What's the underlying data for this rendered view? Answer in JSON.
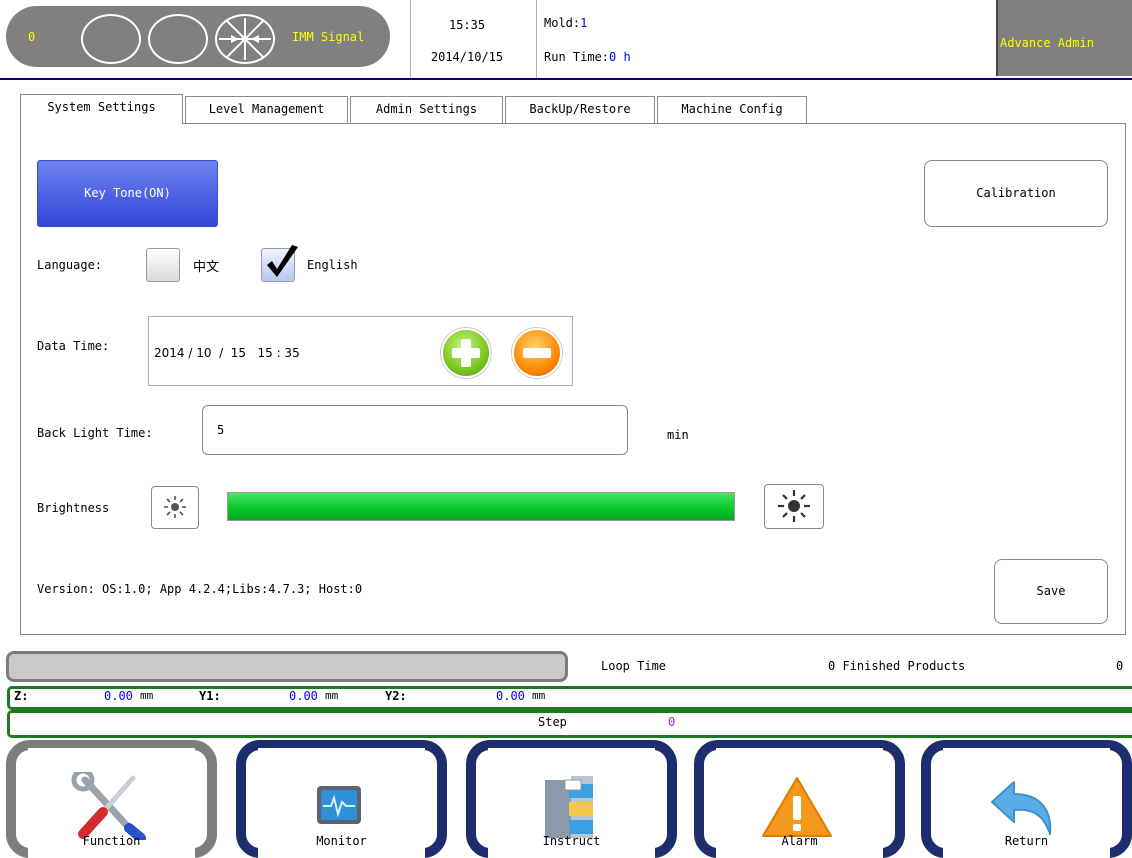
{
  "header": {
    "status_count": "0",
    "imm_signal": "IMM Signal",
    "time": "15:35",
    "date": "2014/10/15",
    "mold_label": "Mold:",
    "mold_value": "1",
    "run_time_label": "Run Time:",
    "run_time_value": "0 h",
    "user_level": "Advance Admin"
  },
  "tabs": [
    {
      "label": "System Settings",
      "active": true
    },
    {
      "label": "Level Management",
      "active": false
    },
    {
      "label": "Admin Settings",
      "active": false
    },
    {
      "label": "BackUp/Restore",
      "active": false
    },
    {
      "label": "Machine Config",
      "active": false
    }
  ],
  "settings": {
    "key_tone_label": "Key Tone(ON)",
    "calibration_label": "Calibration",
    "language_label": "Language:",
    "language_options": [
      {
        "label": "中文",
        "checked": false
      },
      {
        "label": "English",
        "checked": true
      }
    ],
    "date_time_label": "Data Time:",
    "date_time_value": "2014 / 10  /  15   15 : 35",
    "back_light_label": "Back Light Time:",
    "back_light_value": "5",
    "back_light_unit": "min",
    "brightness_label": "Brightness",
    "brightness_level": 1.0,
    "version_text": "Version: OS:1.0; App 4.2.4;Libs:4.7.3; Host:0",
    "save_label": "Save"
  },
  "status": {
    "progress": 1.0,
    "loop_time_label": "Loop Time",
    "finished_label": "0 Finished Products",
    "finished_value": "0",
    "axes": [
      {
        "name": "Z:",
        "value": "0.00",
        "unit": "mm"
      },
      {
        "name": "Y1:",
        "value": "0.00",
        "unit": "mm"
      },
      {
        "name": "Y2:",
        "value": "0.00",
        "unit": "mm"
      }
    ],
    "step_label": "Step",
    "step_value": "0"
  },
  "nav": [
    {
      "label": "Function",
      "icon": "tools-icon",
      "active": true
    },
    {
      "label": "Monitor",
      "icon": "monitor-icon",
      "active": false
    },
    {
      "label": "Instruct",
      "icon": "file-cabinet-icon",
      "active": false
    },
    {
      "label": "Alarm",
      "icon": "warning-icon",
      "active": false
    },
    {
      "label": "Return",
      "icon": "return-arrow-icon",
      "active": false
    }
  ],
  "colors": {
    "accent_blue": "#3346d8",
    "header_gray": "#808080",
    "header_text": "#ffff00",
    "status_green": "#1f7a1f",
    "nav_frame": "#1e2d6e",
    "brightness_green": "#0ccd2e",
    "value_blue": "#0000ff",
    "step_purple": "#a020f0"
  }
}
